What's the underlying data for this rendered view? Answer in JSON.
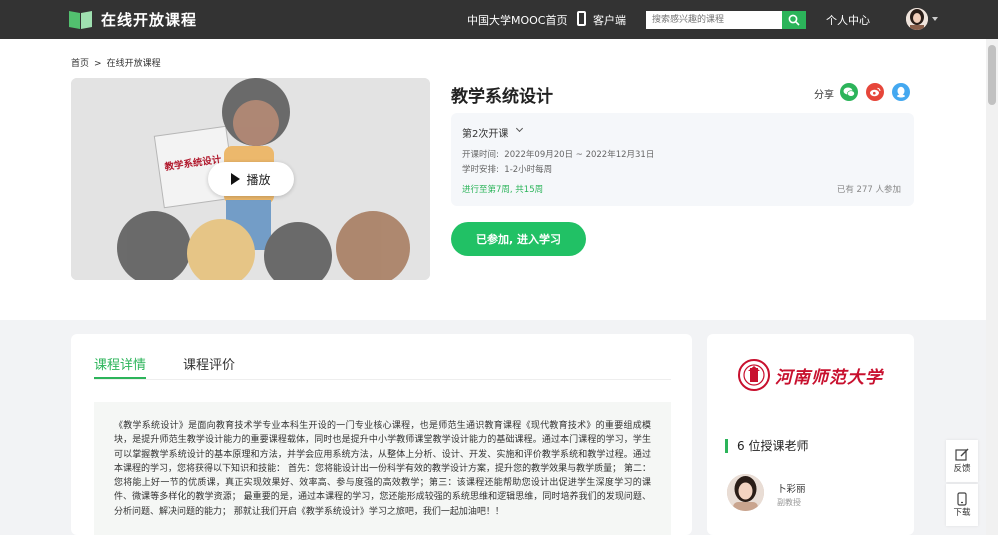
{
  "header": {
    "logo_text": "在线开放课程",
    "nav_mooc": "中国大学MOOC首页",
    "nav_client": "客户端",
    "search_placeholder": "搜索感兴趣的课程",
    "nav_personal": "个人中心"
  },
  "breadcrumb": {
    "home": "首页",
    "separator": ">",
    "current": "在线开放课程"
  },
  "video": {
    "board_text": "教学系统设计",
    "play_label": "播放"
  },
  "course": {
    "title": "教学系统设计",
    "share_label": "分享",
    "term": "第2次开课",
    "time_label": "开课时间:",
    "time_value": "2022年09月20日 ~ 2022年12月31日",
    "schedule_label": "学时安排:",
    "schedule_value": "1-2小时每周",
    "progress": "进行至第7周, 共15周",
    "joined": "已有 277 人参加",
    "enter_button": "已参加, 进入学习"
  },
  "tabs": [
    {
      "label": "课程详情",
      "active": true
    },
    {
      "label": "课程评价",
      "active": false
    }
  ],
  "description": "《教学系统设计》是面向教育技术学专业本科生开设的一门专业核心课程，也是师范生通识教育课程《现代教育技术》的重要组成模块，是提升师范生教学设计能力的重要课程载体，同时也是提升中小学教师课堂教学设计能力的基础课程。通过本门课程的学习，学生可以掌握教学系统设计的基本原理和方法，并学会应用系统方法，从整体上分析、设计、开发、实施和评价教学系统和教学过程。通过本课程的学习，您将获得以下知识和技能： 首先：您将能设计出一份科学有效的教学设计方案，提升您的教学效果与教学质量； 第二：您将能上好一节的优质课，真正实现效果好、效率高、参与度强的高效教学；第三：该课程还能帮助您设计出促进学生深度学习的课件、微课等多样化的教学资源； 最重要的是，通过本课程的学习，您还能形成较强的系统思维和逻辑思维，同时培养我们的发现问题、分析问题、解决问题的能力； 那就让我们开启《教学系统设计》学习之旅吧，我们一起加油吧！！",
  "side": {
    "university": "河南师范大学",
    "teacher_heading": "6 位授课老师",
    "teacher_name": "卜彩丽",
    "teacher_role": "副教授"
  },
  "tools": {
    "feedback": "反馈",
    "download": "下载"
  },
  "colors": {
    "accent": "#2cb45a",
    "button": "#21c165",
    "header": "#333333",
    "university": "#c8102e"
  }
}
